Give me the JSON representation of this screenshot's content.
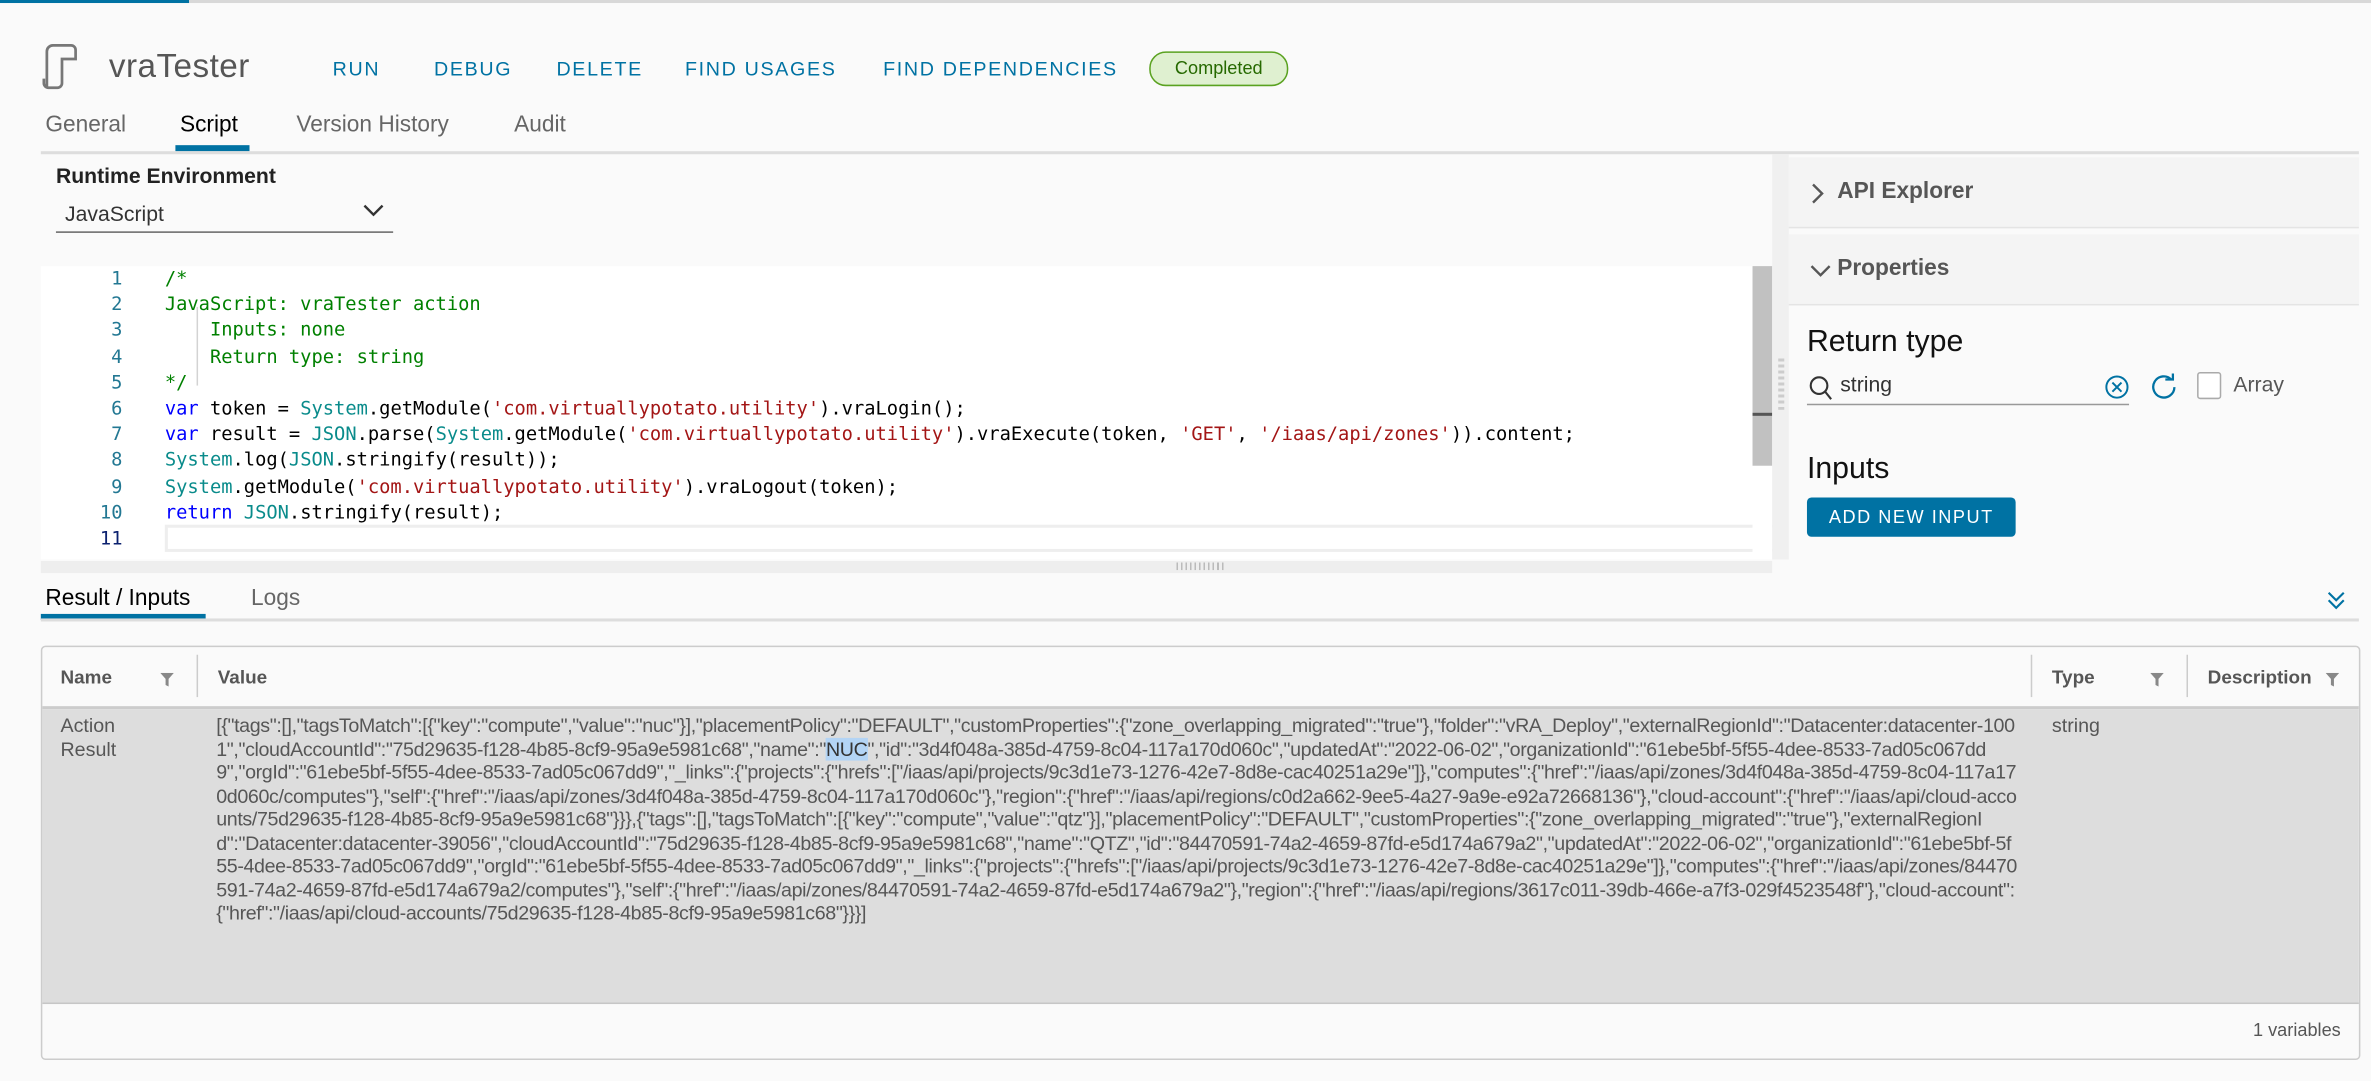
{
  "header": {
    "title": "vraTester",
    "status": "Completed",
    "actions": [
      "RUN",
      "DEBUG",
      "DELETE",
      "FIND USAGES",
      "FIND DEPENDENCIES"
    ]
  },
  "tabs": [
    "General",
    "Script",
    "Version History",
    "Audit"
  ],
  "active_tab": "Script",
  "runtime": {
    "label": "Runtime Environment",
    "value": "JavaScript"
  },
  "code": [
    [
      [
        "c",
        "/*"
      ]
    ],
    [
      [
        "c",
        "JavaScript: vraTester action"
      ]
    ],
    [
      [
        "c",
        "    Inputs: none"
      ]
    ],
    [
      [
        "c",
        "    Return type: string"
      ]
    ],
    [
      [
        "c",
        "*/"
      ]
    ],
    [
      [
        "k",
        "var"
      ],
      [
        "p",
        " token = "
      ],
      [
        "b",
        "System"
      ],
      [
        "p",
        ".getModule("
      ],
      [
        "s",
        "'com.virtuallypotato.utility'"
      ],
      [
        "p",
        ").vraLogin();"
      ]
    ],
    [
      [
        "k",
        "var"
      ],
      [
        "p",
        " result = "
      ],
      [
        "b",
        "JSON"
      ],
      [
        "p",
        ".parse("
      ],
      [
        "b",
        "System"
      ],
      [
        "p",
        ".getModule("
      ],
      [
        "s",
        "'com.virtuallypotato.utility'"
      ],
      [
        "p",
        ").vraExecute(token, "
      ],
      [
        "s",
        "'GET'"
      ],
      [
        "p",
        ", "
      ],
      [
        "s",
        "'/iaas/api/zones'"
      ],
      [
        "p",
        ")).content;"
      ]
    ],
    [
      [
        "b",
        "System"
      ],
      [
        "p",
        ".log("
      ],
      [
        "b",
        "JSON"
      ],
      [
        "p",
        ".stringify(result));"
      ]
    ],
    [
      [
        "b",
        "System"
      ],
      [
        "p",
        ".getModule("
      ],
      [
        "s",
        "'com.virtuallypotato.utility'"
      ],
      [
        "p",
        ").vraLogout(token);"
      ]
    ],
    [
      [
        "k",
        "return"
      ],
      [
        "p",
        " "
      ],
      [
        "b",
        "JSON"
      ],
      [
        "p",
        ".stringify(result);"
      ]
    ],
    []
  ],
  "right_panel": {
    "api_explorer": "API Explorer",
    "properties": "Properties",
    "return_type_label": "Return type",
    "return_type_value": "string",
    "array_label": "Array",
    "inputs_label": "Inputs",
    "add_input": "ADD NEW INPUT"
  },
  "bottom_tabs": [
    "Result / Inputs",
    "Logs"
  ],
  "grid": {
    "columns": [
      "Name",
      "Value",
      "Type",
      "Description"
    ],
    "row": {
      "name": "Action Result",
      "type": "string",
      "value_before": "[{\"tags\":[],\"tagsToMatch\":[{\"key\":\"compute\",\"value\":\"nuc\"}],\"placementPolicy\":\"DEFAULT\",\"customProperties\":{\"zone_overlapping_migrated\":\"true\"},\"folder\":\"vRA_Deploy\",\"externalRegionId\":\"Datacenter:datacenter-1001\",\"cloudAccountId\":\"75d29635-f128-4b85-8cf9-95a9e5981c68\",\"name\":\"",
      "value_selected": "NUC",
      "value_after": "\",\"id\":\"3d4f048a-385d-4759-8c04-117a170d060c\",\"updatedAt\":\"2022-06-02\",\"organizationId\":\"61ebe5bf-5f55-4dee-8533-7ad05c067dd9\",\"orgId\":\"61ebe5bf-5f55-4dee-8533-7ad05c067dd9\",\"_links\":{\"projects\":{\"hrefs\":[\"/iaas/api/projects/9c3d1e73-1276-42e7-8d8e-cac40251a29e\"]},\"computes\":{\"href\":\"/iaas/api/zones/3d4f048a-385d-4759-8c04-117a170d060c/computes\"},\"self\":{\"href\":\"/iaas/api/zones/3d4f048a-385d-4759-8c04-117a170d060c\"},\"region\":{\"href\":\"/iaas/api/regions/c0d2a662-9ee5-4a27-9a9e-e92a72668136\"},\"cloud-account\":{\"href\":\"/iaas/api/cloud-accounts/75d29635-f128-4b85-8cf9-95a9e5981c68\"}}},{\"tags\":[],\"tagsToMatch\":[{\"key\":\"compute\",\"value\":\"qtz\"}],\"placementPolicy\":\"DEFAULT\",\"customProperties\":{\"zone_overlapping_migrated\":\"true\"},\"externalRegionId\":\"Datacenter:datacenter-39056\",\"cloudAccountId\":\"75d29635-f128-4b85-8cf9-95a9e5981c68\",\"name\":\"QTZ\",\"id\":\"84470591-74a2-4659-87fd-e5d174a679a2\",\"updatedAt\":\"2022-06-02\",\"organizationId\":\"61ebe5bf-5f55-4dee-8533-7ad05c067dd9\",\"orgId\":\"61ebe5bf-5f55-4dee-8533-7ad05c067dd9\",\"_links\":{\"projects\":{\"hrefs\":[\"/iaas/api/projects/9c3d1e73-1276-42e7-8d8e-cac40251a29e\"]},\"computes\":{\"href\":\"/iaas/api/zones/84470591-74a2-4659-87fd-e5d174a679a2/computes\"},\"self\":{\"href\":\"/iaas/api/zones/84470591-74a2-4659-87fd-e5d174a679a2\"},\"region\":{\"href\":\"/iaas/api/regions/3617c011-39db-466e-a7f3-029f4523548f\"},\"cloud-account\":{\"href\":\"/iaas/api/cloud-accounts/75d29635-f128-4b85-8cf9-95a9e5981c68\"}}}]"
    },
    "footer": "1 variables"
  },
  "colors": {
    "accent": "#0072a3",
    "status_bg": "#dff0d0",
    "status_border": "#5aa220",
    "status_text": "#266900"
  },
  "icons": [
    "action-script-icon",
    "chevron-down-icon",
    "chevron-right-icon",
    "search-icon",
    "clear-icon",
    "refresh-icon",
    "filter-icon",
    "double-chevron-down-icon"
  ]
}
